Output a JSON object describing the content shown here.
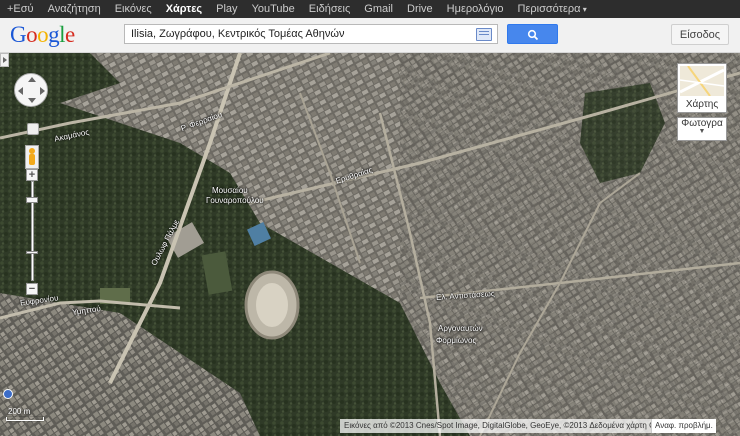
{
  "gbar": {
    "items": [
      "+Εσύ",
      "Αναζήτηση",
      "Εικόνες",
      "Χάρτες",
      "Play",
      "YouTube",
      "Ειδήσεις",
      "Gmail",
      "Drive",
      "Ημερολόγιο",
      "Περισσότερα"
    ]
  },
  "header": {
    "logo_letters": [
      "G",
      "o",
      "o",
      "g",
      "l",
      "e"
    ],
    "logo_colors": [
      "#1a57d6",
      "#d62d20",
      "#f4b400",
      "#1a57d6",
      "#1a9e3e",
      "#d62d20"
    ],
    "search_value": "Ilisia, Ζωγράφου, Κεντρικός Τομέας Αθηνών",
    "signin_label": "Είσοδος"
  },
  "map": {
    "labels": [
      "Ακαμάνος",
      "Ρ. Φερραίου",
      "Μουσαίου",
      "Γουναροπούλου",
      "Ερυθραίας",
      "Ουλωφ Πάλμε",
      "Ευφρονίου",
      "Υμηττού",
      "Ελ. Αντιστάσεως",
      "Αργοναυτών",
      "Φορμίωνος"
    ],
    "map_type_label": "Χάρτης",
    "photo_label": "Φωτογρα",
    "attribution": "Εικόνες από ©2013 Cnes/Spot Image, DigitalGlobe, GeoEye, ©2013 Δεδομένα χάρτη Google",
    "problem_label": "Αναφ. προβλήμ.",
    "scale_label": "200 m"
  }
}
